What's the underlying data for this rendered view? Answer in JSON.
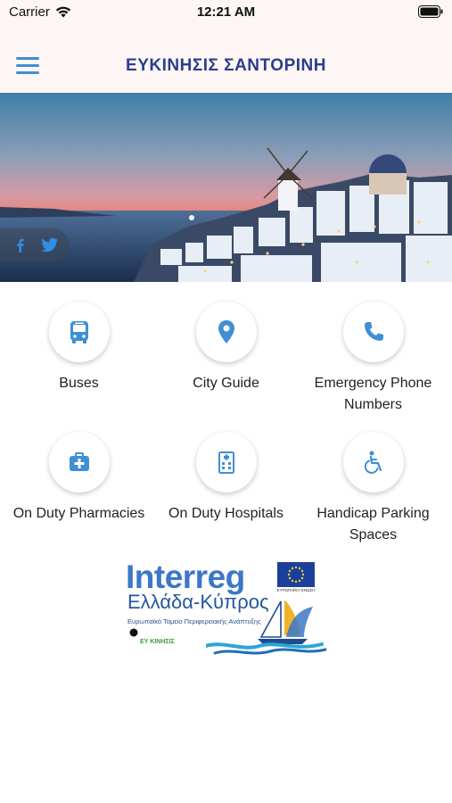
{
  "status_bar": {
    "carrier": "Carrier",
    "time": "12:21 AM"
  },
  "header": {
    "title": "ΕΥΚΙΝΗΣΙΣ ΣΑΝΤΟΡΙΝΗ",
    "menu_icon": "hamburger-menu-icon"
  },
  "social": {
    "facebook_icon": "facebook-icon",
    "twitter_icon": "twitter-icon"
  },
  "tiles": [
    {
      "label": "Buses",
      "icon": "bus-icon"
    },
    {
      "label": "City Guide",
      "icon": "map-marker-icon"
    },
    {
      "label": "Emergency Phone Numbers",
      "icon": "phone-icon"
    },
    {
      "label": "On Duty Pharmacies",
      "icon": "medkit-icon"
    },
    {
      "label": "On Duty Hospitals",
      "icon": "hospital-building-icon"
    },
    {
      "label": "Handicap Parking Spaces",
      "icon": "wheelchair-icon"
    }
  ],
  "logo": {
    "word": "Interreg",
    "subtitle": "Ελλάδα-Κύπρος",
    "tagline": "Ευρωπαϊκό Ταμείο Περιφερειακής Ανάπτυξης",
    "eu_caption": "ΕΥΡΩΠΑΪΚΗ ΕΝΩΣΗ",
    "small_label": "ΕΥ ΚΙΝΗΣΙΣ"
  },
  "colors": {
    "accent": "#3f8fd2",
    "title": "#2a3d8f",
    "header_bg": "#fdf6f4"
  }
}
